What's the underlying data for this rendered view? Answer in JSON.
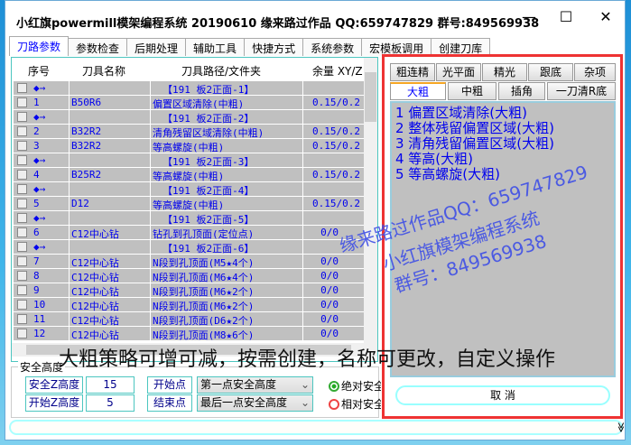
{
  "window": {
    "title": "小红旗powermill模架编程系统 20190610   缘来路过作品 QQ:659747829  群号:849569938",
    "minimize": "—",
    "maximize": "☐",
    "close": "✕"
  },
  "tabs": [
    "刀路参数",
    "参数检查",
    "后期处理",
    "辅助工具",
    "快捷方式",
    "系统参数",
    "宏模板调用",
    "创建刀库"
  ],
  "table": {
    "headers": [
      "序号",
      "刀具名称",
      "刀具路径/文件夹",
      "余量 XY/Z"
    ],
    "rows": [
      {
        "seq": "◆→",
        "tool": "",
        "path": "【191 板2正面-1】",
        "margin": ""
      },
      {
        "seq": "1",
        "tool": "B50R6",
        "path": "偏置区域清除(中粗)",
        "margin": "0.15/0.2"
      },
      {
        "seq": "◆→",
        "tool": "",
        "path": "【191 板2正面-2】",
        "margin": ""
      },
      {
        "seq": "2",
        "tool": "B32R2",
        "path": "清角残留区域清除(中粗)",
        "margin": "0.15/0.2"
      },
      {
        "seq": "3",
        "tool": "B32R2",
        "path": "等高螺旋(中粗)",
        "margin": "0.15/0.2"
      },
      {
        "seq": "◆→",
        "tool": "",
        "path": "【191 板2正面-3】",
        "margin": ""
      },
      {
        "seq": "4",
        "tool": "B25R2",
        "path": "等高螺旋(中粗)",
        "margin": "0.15/0.2"
      },
      {
        "seq": "◆→",
        "tool": "",
        "path": "【191 板2正面-4】",
        "margin": ""
      },
      {
        "seq": "5",
        "tool": "D12",
        "path": "等高螺旋(中粗)",
        "margin": "0.15/0.2"
      },
      {
        "seq": "◆→",
        "tool": "",
        "path": "【191 板2正面-5】",
        "margin": ""
      },
      {
        "seq": "6",
        "tool": "C12中心钻",
        "path": "钻孔到孔顶面(定位点)",
        "margin": "0/0"
      },
      {
        "seq": "◆→",
        "tool": "",
        "path": "【191 板2正面-6】",
        "margin": ""
      },
      {
        "seq": "7",
        "tool": "C12中心钻",
        "path": "N段到孔顶面(M5★4个)",
        "margin": "0/0"
      },
      {
        "seq": "8",
        "tool": "C12中心钻",
        "path": "N段到孔顶面(M6★4个)",
        "margin": "0/0"
      },
      {
        "seq": "9",
        "tool": "C12中心钻",
        "path": "N段到孔顶面(M6★2个)",
        "margin": "0/0"
      },
      {
        "seq": "10",
        "tool": "C12中心钻",
        "path": "N段到孔顶面(M6★2个)",
        "margin": "0/0"
      },
      {
        "seq": "11",
        "tool": "C12中心钻",
        "path": "N段到孔顶面(D6★2个)",
        "margin": "0/0"
      },
      {
        "seq": "12",
        "tool": "C12中心钻",
        "path": "N段到孔顶面(M8★6个)",
        "margin": "0/0"
      }
    ]
  },
  "safety": {
    "group_label": "安全高度",
    "safe_z_label": "安全Z高度",
    "safe_z": "15",
    "start_z_label": "开始Z高度",
    "start_z": "5",
    "start_point_label": "开始点",
    "start_point": "第一点安全高度",
    "end_point_label": "结束点",
    "end_point": "最后一点安全高度",
    "radio_abs": "绝对安全",
    "radio_rel": "相对安全"
  },
  "right": {
    "tabs_row1": [
      "粗连精",
      "光平面",
      "精光",
      "跟底",
      "杂项"
    ],
    "tabs_row2": [
      "大粗",
      "中粗",
      "插角",
      "一刀清R底"
    ],
    "items": [
      "1 偏置区域清除(大粗)",
      "2 整体残留偏置区域(大粗)",
      "3 清角残留偏置区域(大粗)",
      "4 等高(大粗)",
      "5 等高螺旋(大粗)"
    ],
    "cancel": "取 消"
  },
  "overlay_text": "大粗策略可增可减，按需创建，名称可更改，自定义操作",
  "watermark": [
    "缘来路过作品QQ：659747829",
    "小红旗模架编程系统",
    "群号：849569938"
  ],
  "bottom_toggle": "≫"
}
